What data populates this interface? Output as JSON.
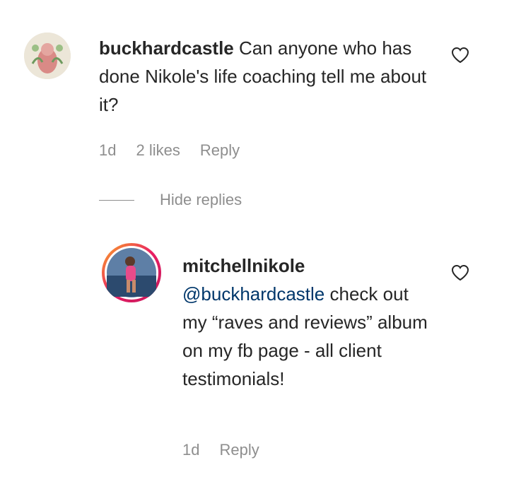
{
  "comment": {
    "username": "buckhardcastle",
    "text": "Can anyone who has done Nikole's life coaching tell me about it?",
    "time": "1d",
    "likes": "2 likes",
    "reply_label": "Reply",
    "avatar_icon": "floral-avatar-icon",
    "like_icon": "heart-outline-icon"
  },
  "hide_replies_label": "Hide replies",
  "reply": {
    "username": "mitchellnikole",
    "mention": "@buckhardcastle",
    "text": "check out my “raves and reviews” album on my fb page - all client testimonials!",
    "time": "1d",
    "reply_label": "Reply",
    "avatar_icon": "profile-photo-avatar-icon",
    "like_icon": "heart-outline-icon"
  },
  "colors": {
    "text": "#262626",
    "secondary": "#8e8e8e",
    "mention": "#00376b",
    "story_ring_start": "#f9a825",
    "story_ring_end": "#c2185b"
  }
}
